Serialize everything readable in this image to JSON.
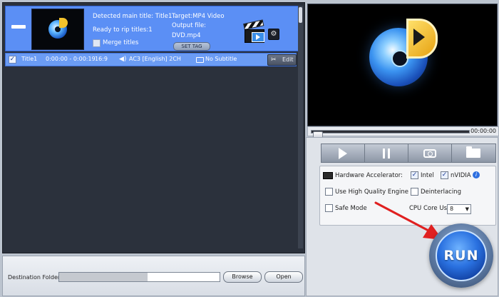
{
  "source": {
    "detected_title": "Detected main title: Title1",
    "ready_titles": "Ready to rip titles:1",
    "merge_label": "Merge titles",
    "merge_checked": false,
    "target": "Target:MP4 Video",
    "output_file_label": "Output file:",
    "output_file": "DVD.mp4",
    "settag_label": "SET TAG"
  },
  "title_row": {
    "checked": true,
    "name": "Title1",
    "time": "0:00:00 - 0:00:19",
    "aspect": "16:9",
    "audio": "AC3  [English]  2CH",
    "subtitle": "No Subtitle",
    "edit_label": "Edit"
  },
  "destination": {
    "label": "Destination Folder:",
    "value": "",
    "browse_label": "Browse",
    "open_label": "Open"
  },
  "preview": {
    "time": "00:00:00"
  },
  "options": {
    "hw_label": "Hardware Accelerator:",
    "intel_label": "Intel",
    "intel_checked": true,
    "nvidia_label": "nVIDIA",
    "nvidia_checked": true,
    "hq_label": "Use High Quality Engine",
    "hq_checked": false,
    "deint_label": "Deinterlacing",
    "deint_checked": false,
    "safe_label": "Safe Mode",
    "safe_checked": false,
    "cpu_label": "CPU Core Use:",
    "cpu_value": "8"
  },
  "run_label": "RUN",
  "colors": {
    "selection_blue": "#5b8ff5",
    "list_background": "#2b313c",
    "run_blue": "#2a71e0",
    "arrow_red": "#e02020"
  }
}
